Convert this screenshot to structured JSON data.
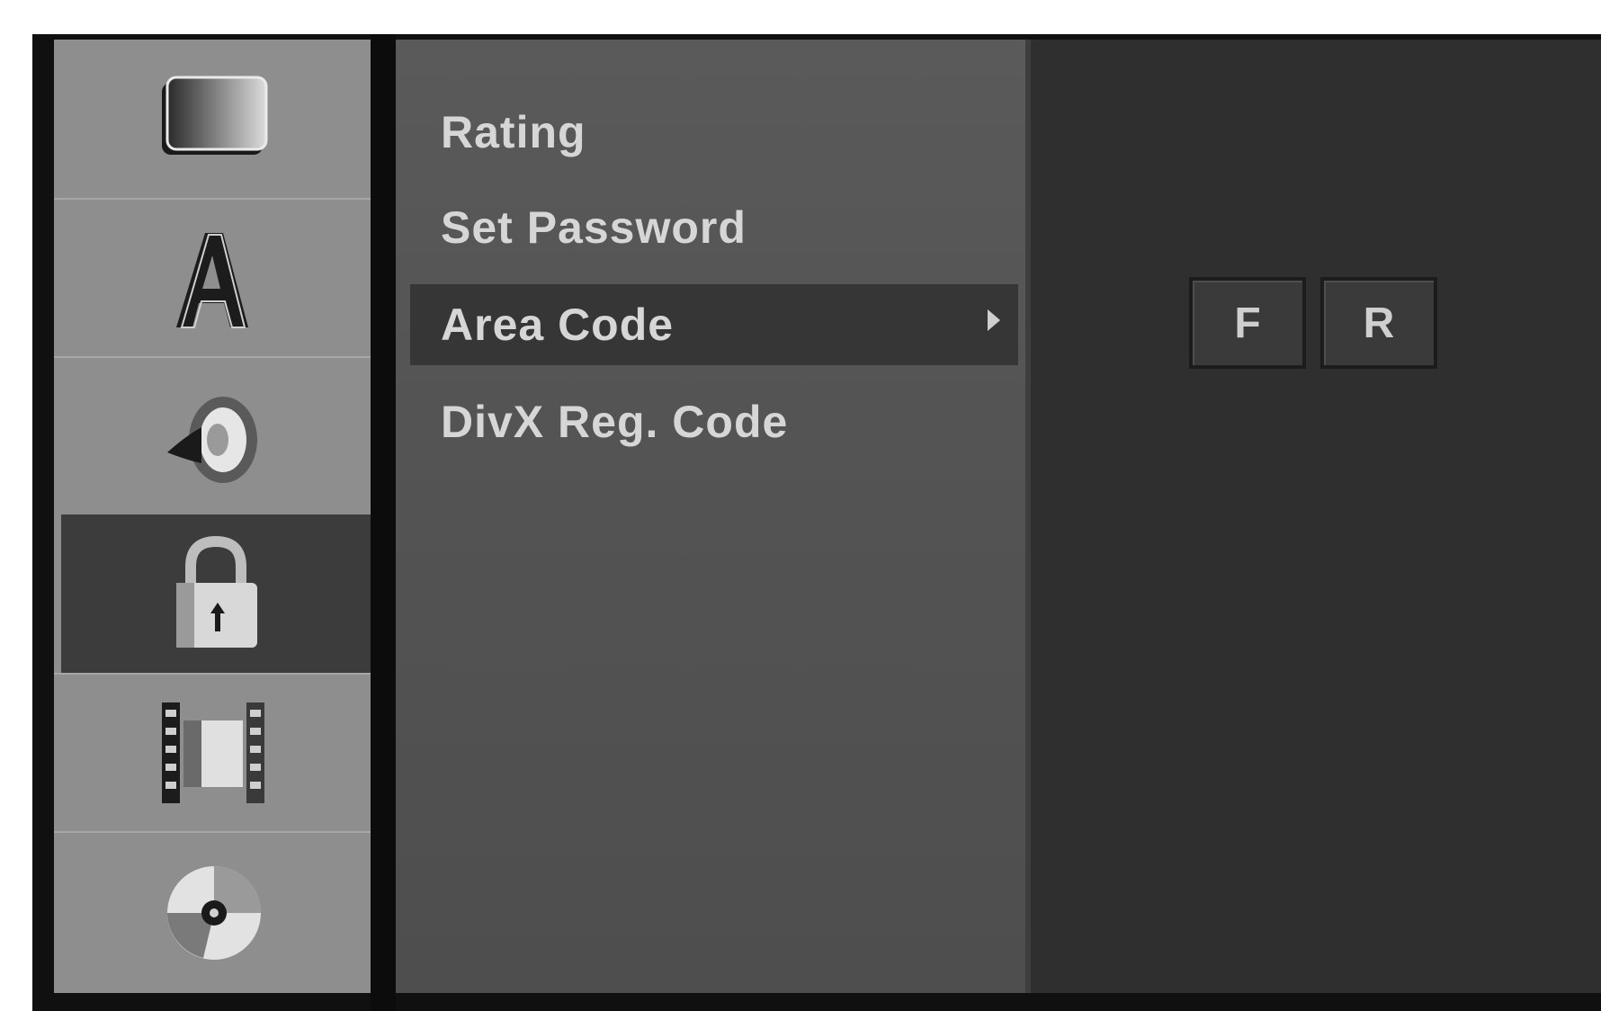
{
  "sidebar": {
    "items": [
      {
        "icon": "tv-screen-icon"
      },
      {
        "icon": "language-a-icon"
      },
      {
        "icon": "speaker-icon"
      },
      {
        "icon": "lock-icon",
        "selected": true
      },
      {
        "icon": "film-icon"
      },
      {
        "icon": "disc-icon"
      }
    ]
  },
  "menu": {
    "items": [
      {
        "label": "Rating"
      },
      {
        "label": "Set Password"
      },
      {
        "label": "Area Code",
        "selected": true
      },
      {
        "label": "DivX Reg. Code"
      }
    ]
  },
  "area_code": {
    "chars": [
      "F",
      "R"
    ]
  },
  "colors": {
    "sidebar": "#8e8e8e",
    "selected": "#363636",
    "menu": "#555555",
    "panel": "#2f2f2f",
    "text": "#d6d6d6"
  }
}
